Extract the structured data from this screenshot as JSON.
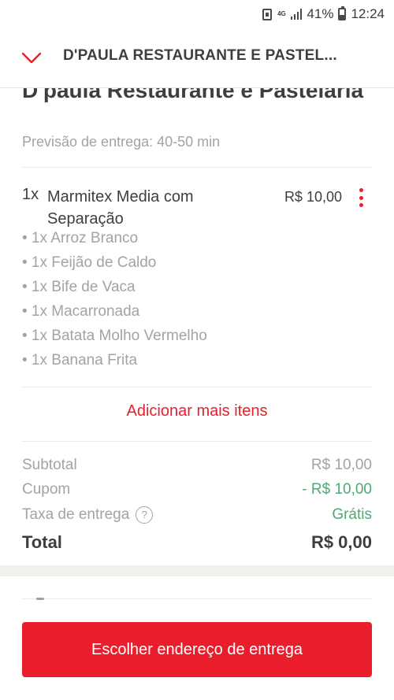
{
  "status_bar": {
    "network": "4G",
    "battery": "41%",
    "time": "12:24"
  },
  "header": {
    "title": "D'PAULA RESTAURANTE E PASTEL..."
  },
  "restaurant": {
    "name": "D'paula Restaurante e Pastelaria",
    "delivery_estimate": "Previsão de entrega: 40-50 min"
  },
  "order_item": {
    "quantity": "1x",
    "name": "Marmitex Media com Separação",
    "price": "R$ 10,00",
    "sub_items": [
      "• 1x Arroz Branco",
      "• 1x Feijão de Caldo",
      "• 1x Bife de Vaca",
      "• 1x Macarronada",
      "• 1x Batata Molho Vermelho",
      "• 1x Banana Frita"
    ]
  },
  "add_more_label": "Adicionar mais itens",
  "summary": {
    "subtotal_label": "Subtotal",
    "subtotal_value": "R$ 10,00",
    "coupon_label": "Cupom",
    "coupon_value": "- R$ 10,00",
    "delivery_fee_label": "Taxa de entrega",
    "delivery_fee_help": "?",
    "delivery_fee_value": "Grátis",
    "total_label": "Total",
    "total_value": "R$ 0,00"
  },
  "cta_label": "Escolher endereço de entrega",
  "colors": {
    "accent": "#ea1d2c",
    "success": "#50a773",
    "text": "#3f3e3e",
    "muted": "#a6a29f"
  },
  "icons": {
    "header_left": "chevron-down-icon",
    "item_menu": "more-vertical-icon",
    "fee_help": "help-circle-icon"
  }
}
